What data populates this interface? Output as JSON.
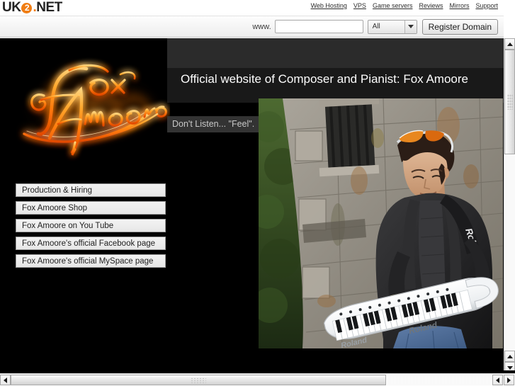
{
  "browser": {
    "vertical_scrollbar": {
      "up_icon": "triangle-up-icon",
      "down_icon": "triangle-down-icon"
    },
    "horizontal_scrollbar": {
      "left_icon": "triangle-left-icon",
      "right_icon": "triangle-right-icon"
    }
  },
  "uk2_bar": {
    "logo": {
      "part1": "UK",
      "badge": "2",
      "dot": ".",
      "part2": "NET",
      "accent_color": "#f07d13"
    },
    "nav_links": [
      {
        "label": "Web Hosting"
      },
      {
        "label": "VPS"
      },
      {
        "label": "Game servers"
      },
      {
        "label": "Reviews"
      },
      {
        "label": "Mirrors"
      },
      {
        "label": "Support"
      }
    ]
  },
  "domain_search": {
    "www_prefix": "www.",
    "input_value": "",
    "input_placeholder": "",
    "tld_selected": "All",
    "tld_options": [
      "All"
    ],
    "register_button": "Register Domain",
    "dropdown_icon": "chevron-down-icon"
  },
  "site": {
    "logo_text": "Fox Amoore",
    "logo_line1": "Fox",
    "logo_line2": "Amoore",
    "title": "Official website of Composer and Pianist: Fox Amoore",
    "tagline": "Don't Listen... \"Feel\".",
    "menu": [
      {
        "label": "Production & Hiring"
      },
      {
        "label": "Fox Amoore Shop"
      },
      {
        "label": "Fox Amoore on You Tube"
      },
      {
        "label": "Fox Amoore's official Facebook page"
      },
      {
        "label": "Fox Amoore's official MySpace page"
      }
    ],
    "photo": {
      "alt": "Man playing a white Roland keytar in front of a stone building",
      "keytar_brand": "Roland",
      "strap_brand": "Roland"
    },
    "colors": {
      "background": "#000000",
      "header_strip": "#2b2b2b",
      "title_band": "#191919",
      "tagline_chip": "#333333",
      "menu_button": "#efefef",
      "logo_orange": "#ff7a10"
    }
  }
}
